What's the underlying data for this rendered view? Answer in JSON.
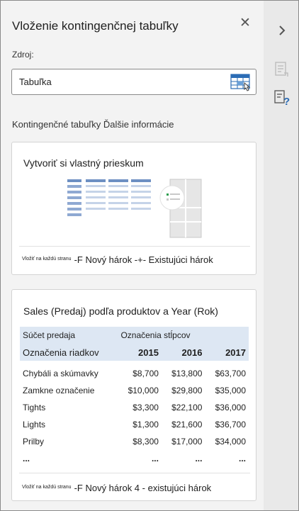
{
  "pane": {
    "title": "Vloženie kontingenčnej tabuľky",
    "source_label": "Zdroj:",
    "source_value": "Tabuľka",
    "section_title": "Kontingenčné tabuľky Ďalšie informácie"
  },
  "card_custom": {
    "title": "Vytvoriť si vlastný prieskum",
    "footer_small": "Vložiť na každú stranu",
    "footer_text": "-F Nový hárok -+- Existujúci hárok"
  },
  "card_suggestion": {
    "title": "Sales (Predaj) podľa produktov a Year (Rok)",
    "sum_label": "Súčet predaja",
    "col_labels": "Označenia stĺpcov",
    "row_labels": "Označenia riadkov",
    "years": [
      "2015",
      "2016",
      "2017"
    ],
    "rows": [
      {
        "name": "Chybáli a skúmavky",
        "values": [
          "$8,700",
          "$13,800",
          "$63,700"
        ]
      },
      {
        "name": "Zamkne označenie",
        "values": [
          "$10,000",
          "$29,800",
          "$35,000"
        ]
      },
      {
        "name": "Tights",
        "values": [
          "$3,300",
          "$22,100",
          "$36,000"
        ]
      },
      {
        "name": "Lights",
        "values": [
          "$1,300",
          "$21,600",
          "$36,700"
        ]
      },
      {
        "name": "Prilby",
        "values": [
          "$8,300",
          "$17,000",
          "$34,000"
        ]
      }
    ],
    "ellipsis": "...",
    "footer_small": "Vložiť na každú stranu",
    "footer_text": "-F Nový hárok 4 - existujúci hárok"
  },
  "icons": {
    "close": "close-icon",
    "source_picker": "table-select-icon",
    "rail_expand": "chevron-right-icon",
    "rail_fields": "field-list-icon",
    "rail_help": "help-icon"
  },
  "colors": {
    "accent_blue": "#2b6cb5",
    "table_header": "#dde7f3"
  }
}
